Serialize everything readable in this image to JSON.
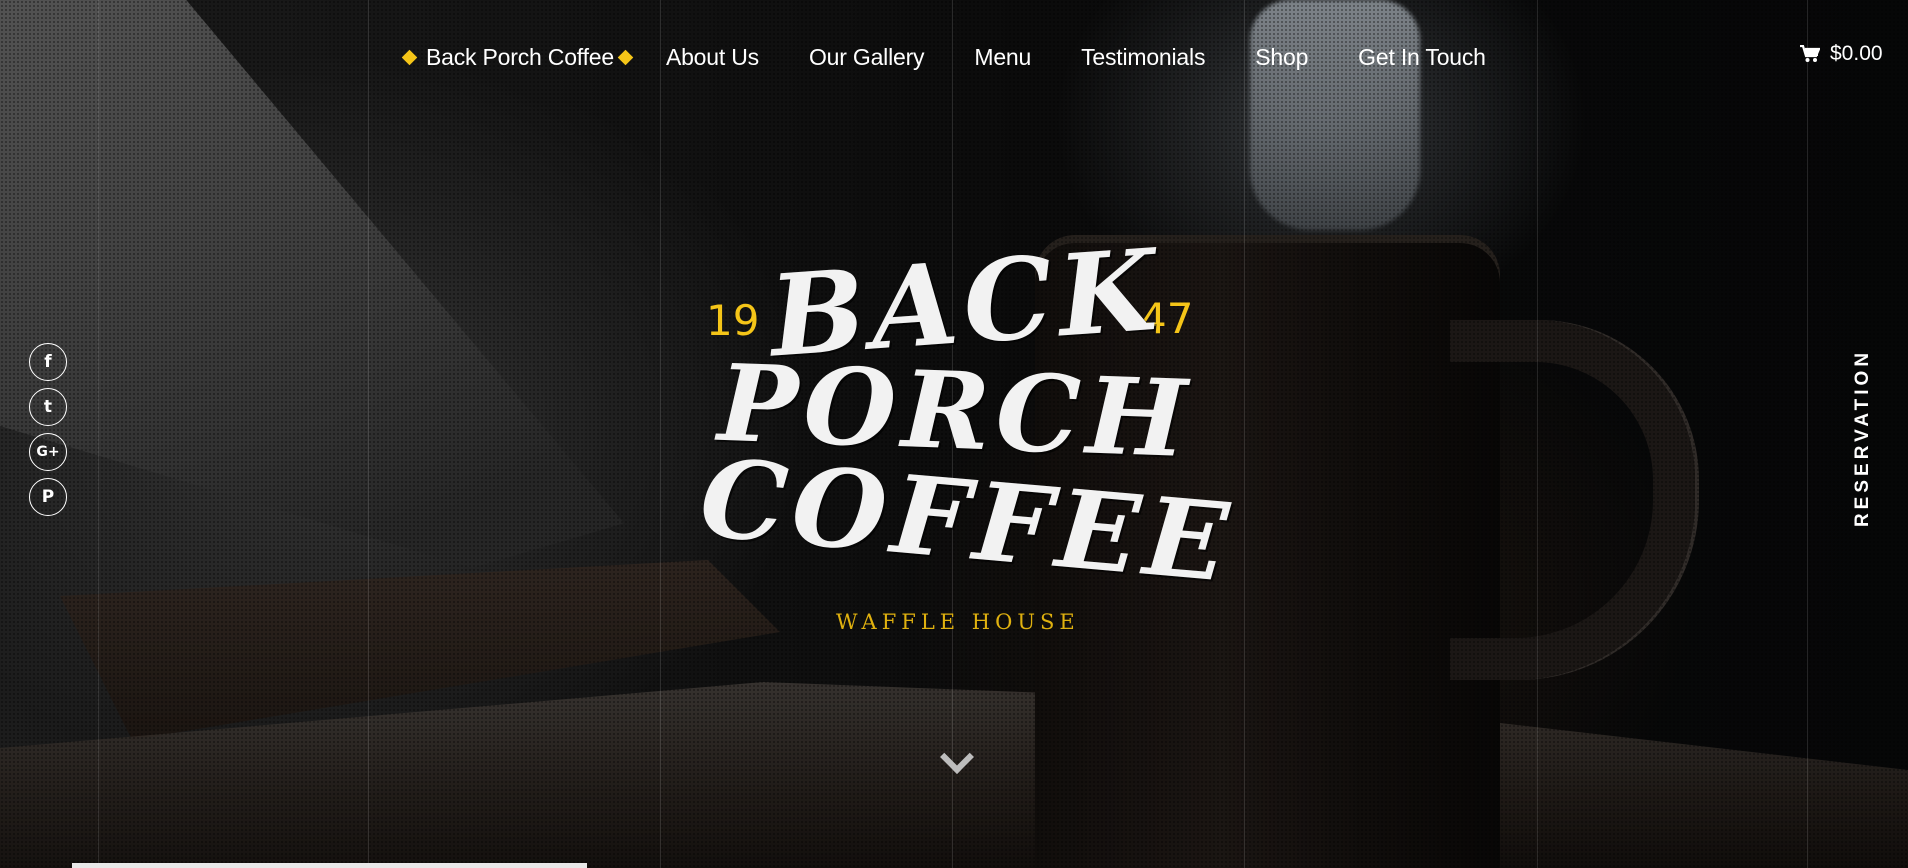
{
  "nav": {
    "brand": "Back Porch Coffee",
    "items": [
      {
        "label": "About Us"
      },
      {
        "label": "Our Gallery"
      },
      {
        "label": "Menu"
      },
      {
        "label": "Testimonials"
      },
      {
        "label": "Shop"
      },
      {
        "label": "Get In Touch"
      }
    ],
    "accent_color": "#f5c518"
  },
  "cart": {
    "icon": "cart-icon",
    "total": "$0.00"
  },
  "social": [
    {
      "icon": "facebook-icon",
      "glyph": "f"
    },
    {
      "icon": "twitter-icon",
      "glyph": "t"
    },
    {
      "icon": "google-plus-icon",
      "glyph": "G+"
    },
    {
      "icon": "pinterest-icon",
      "glyph": "P"
    }
  ],
  "reservation": {
    "label": "RESERVATION"
  },
  "logo": {
    "line1": "BACK",
    "line2": "PORCH",
    "line3": "COFFEE",
    "year_left": "19",
    "year_right": "47",
    "tagline": "WAFFLE HOUSE"
  },
  "scroll": {
    "icon": "chevron-down-icon"
  }
}
